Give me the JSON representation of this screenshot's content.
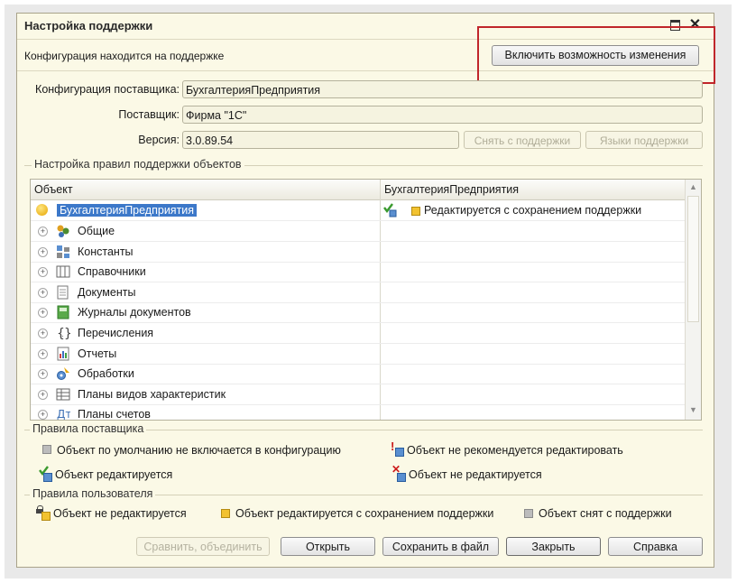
{
  "window": {
    "title": "Настройка поддержки"
  },
  "status": {
    "text": "Конфигурация находится на поддержке",
    "enable_button": "Включить возможность изменения"
  },
  "fields": {
    "vendor_config_label": "Конфигурация поставщика:",
    "vendor_config_value": "БухгалтерияПредприятия",
    "vendor_label": "Поставщик:",
    "vendor_value": "Фирма \"1С\"",
    "version_label": "Версия:",
    "version_value": "3.0.89.54",
    "remove_support_button": "Снять с поддержки",
    "languages_button": "Языки поддержки"
  },
  "rules_group": {
    "title": "Настройка правил поддержки объектов"
  },
  "tree": {
    "col_object": "Объект",
    "col_vendor": "БухгалтерияПредприятия",
    "root": {
      "name": "БухгалтерияПредприятия",
      "rule": "Редактируется с сохранением поддержки"
    },
    "items": [
      {
        "name": "Общие",
        "icon": "common-icon"
      },
      {
        "name": "Константы",
        "icon": "constants-icon"
      },
      {
        "name": "Справочники",
        "icon": "catalogs-icon"
      },
      {
        "name": "Документы",
        "icon": "documents-icon"
      },
      {
        "name": "Журналы документов",
        "icon": "journals-icon"
      },
      {
        "name": "Перечисления",
        "icon": "enums-icon"
      },
      {
        "name": "Отчеты",
        "icon": "reports-icon"
      },
      {
        "name": "Обработки",
        "icon": "processing-icon"
      },
      {
        "name": "Планы видов характеристик",
        "icon": "char-types-icon"
      },
      {
        "name": "Планы счетов",
        "icon": "accounts-icon"
      }
    ]
  },
  "vendor_rules": {
    "title": "Правила поставщика",
    "not_included": "Объект по умолчанию не включается в конфигурацию",
    "not_recommended": "Объект не рекомендуется редактировать",
    "editable": "Объект редактируется",
    "not_editable": "Объект не редактируется"
  },
  "user_rules": {
    "title": "Правила пользователя",
    "not_editable": "Объект не редактируется",
    "editable_with_support": "Объект редактируется с сохранением поддержки",
    "removed_from_support": "Объект снят с поддержки"
  },
  "buttons": {
    "compare": "Сравнить, объединить",
    "open": "Открыть",
    "save": "Сохранить в файл",
    "close": "Закрыть",
    "help": "Справка"
  }
}
